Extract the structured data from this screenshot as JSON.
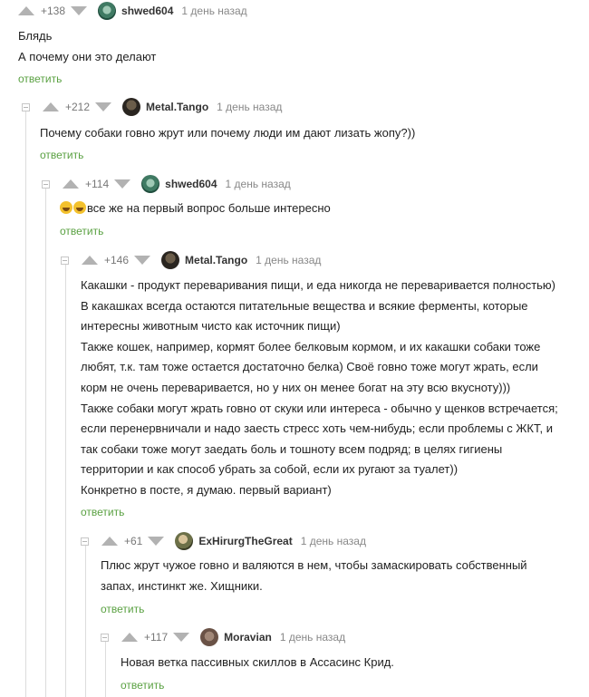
{
  "colors": {
    "reply_link": "#5aa142",
    "vote_arrow": "#b2b2b2",
    "thread_line": "#dcdcdc"
  },
  "reply_label": "ответить",
  "comments": [
    {
      "rating": "+138",
      "user": "shwed604",
      "avatar": "avatar-icon",
      "time": "1 день назад",
      "lines": [
        "Блядь",
        "А почему они это делают"
      ]
    },
    {
      "rating": "+212",
      "user": "Metal.Tango",
      "avatar": "avatar-icon",
      "time": "1 день назад",
      "lines": [
        "Почему собаки говно жрут или почему люди им дают лизать жопу?))"
      ]
    },
    {
      "rating": "+114",
      "user": "shwed604",
      "avatar": "avatar-icon",
      "time": "1 день назад",
      "emoji": "laughing-emoji-icon",
      "lines": [
        "все же на первый вопрос больше интересно"
      ]
    },
    {
      "rating": "+146",
      "user": "Metal.Tango",
      "avatar": "avatar-icon",
      "time": "1 день назад",
      "lines": [
        "Какашки - продукт переваривания пищи, и еда никогда не переваривается полностью)",
        "В какашках всегда остаются питательные вещества и всякие ферменты, которые",
        "интересны животным чисто как источник пищи)",
        "Также кошек, например, кормят более белковым кормом, и их какашки собаки тоже",
        "любят, т.к. там тоже остается достаточно белка) Своё говно тоже могут жрать, если",
        "корм не очень переваривается, но у них он менее богат на эту всю вкусноту)))",
        "Также собаки могут жрать говно от скуки или интереса - обычно у щенков встречается;",
        "если перенервничали и надо заесть стресс хоть чем-нибудь; если проблемы с ЖКТ, и",
        "так собаки тоже могут заедать боль и тошноту всем подряд; в целях гигиены",
        "территории и как способ убрать за собой, если их ругают за туалет))",
        "Конкретно в посте, я думаю. первый вариант)"
      ]
    },
    {
      "rating": "+61",
      "user": "ExHirurgTheGreat",
      "avatar": "avatar-icon",
      "time": "1 день назад",
      "lines": [
        "Плюс жрут чужое говно и валяются в нем, чтобы замаскировать собственный",
        "запах, инстинкт же. Хищники."
      ]
    },
    {
      "rating": "+117",
      "user": "Moravian",
      "avatar": "avatar-icon",
      "time": "1 день назад",
      "lines": [
        "Новая ветка пассивных скиллов в Ассасинс Крид."
      ]
    }
  ]
}
